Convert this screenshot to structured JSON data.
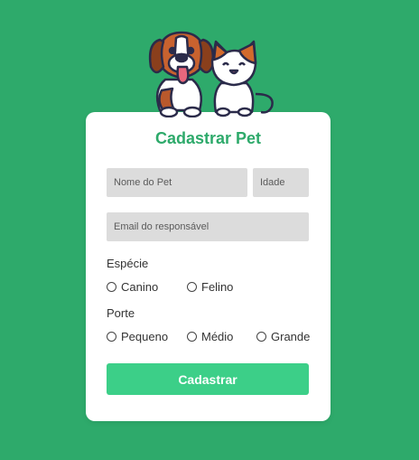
{
  "form": {
    "title": "Cadastrar Pet",
    "pet_name": {
      "placeholder": "Nome do Pet",
      "value": ""
    },
    "age": {
      "placeholder": "Idade",
      "value": ""
    },
    "email": {
      "placeholder": "Email do responsável",
      "value": ""
    },
    "species": {
      "label": "Espécie",
      "options": [
        "Canino",
        "Felino"
      ],
      "selected": null
    },
    "size": {
      "label": "Porte",
      "options": [
        "Pequeno",
        "Médio",
        "Grande"
      ],
      "selected": null
    },
    "submit_label": "Cadastrar"
  },
  "mascot": {
    "icons": [
      "dog-illustration",
      "cat-illustration"
    ]
  },
  "colors": {
    "background": "#2eaa6b",
    "title": "#2eaa6b",
    "button": "#3ccf88",
    "input_bg": "#dcdcdc",
    "card": "#ffffff"
  }
}
